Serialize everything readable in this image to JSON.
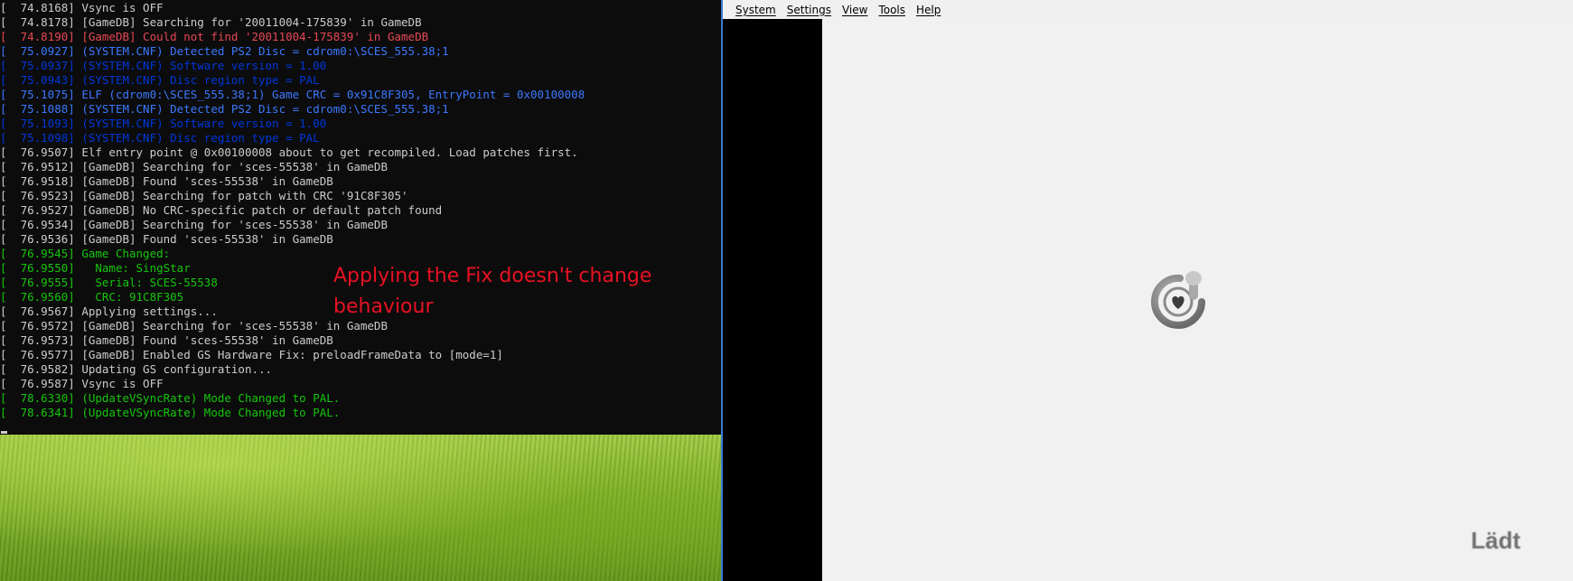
{
  "console": {
    "lines": [
      {
        "time": "74.8168",
        "text": "Vsync is OFF",
        "color": "default"
      },
      {
        "time": "74.8178",
        "text": "[GameDB] Searching for '20011004-175839' in GameDB",
        "color": "default"
      },
      {
        "time": "74.8190",
        "text": "[GameDB] Could not find '20011004-175839' in GameDB",
        "color": "red"
      },
      {
        "time": "75.0927",
        "text": "(SYSTEM.CNF) Detected PS2 Disc = cdrom0:\\SCES_555.38;1",
        "color": "blue"
      },
      {
        "time": "75.0937",
        "text": "(SYSTEM.CNF) Software version = 1.00",
        "color": "darkblue"
      },
      {
        "time": "75.0943",
        "text": "(SYSTEM.CNF) Disc region type = PAL",
        "color": "darkblue"
      },
      {
        "time": "75.1075",
        "text": "ELF (cdrom0:\\SCES_555.38;1) Game CRC = 0x91C8F305, EntryPoint = 0x00100008",
        "color": "blue"
      },
      {
        "time": "75.1088",
        "text": "(SYSTEM.CNF) Detected PS2 Disc = cdrom0:\\SCES_555.38;1",
        "color": "blue"
      },
      {
        "time": "75.1093",
        "text": "(SYSTEM.CNF) Software version = 1.00",
        "color": "darkblue"
      },
      {
        "time": "75.1098",
        "text": "(SYSTEM.CNF) Disc region type = PAL",
        "color": "darkblue"
      },
      {
        "time": "76.9507",
        "text": "Elf entry point @ 0x00100008 about to get recompiled. Load patches first.",
        "color": "default"
      },
      {
        "time": "76.9512",
        "text": "[GameDB] Searching for 'sces-55538' in GameDB",
        "color": "default"
      },
      {
        "time": "76.9518",
        "text": "[GameDB] Found 'sces-55538' in GameDB",
        "color": "default"
      },
      {
        "time": "76.9523",
        "text": "[GameDB] Searching for patch with CRC '91C8F305'",
        "color": "default"
      },
      {
        "time": "76.9527",
        "text": "[GameDB] No CRC-specific patch or default patch found",
        "color": "default"
      },
      {
        "time": "76.9534",
        "text": "[GameDB] Searching for 'sces-55538' in GameDB",
        "color": "default"
      },
      {
        "time": "76.9536",
        "text": "[GameDB] Found 'sces-55538' in GameDB",
        "color": "default"
      },
      {
        "time": "76.9545",
        "text": "Game Changed:",
        "color": "green"
      },
      {
        "time": "76.9550",
        "text": "  Name: SingStar",
        "color": "green"
      },
      {
        "time": "76.9555",
        "text": "  Serial: SCES-55538",
        "color": "green"
      },
      {
        "time": "76.9560",
        "text": "  CRC: 91C8F305",
        "color": "green"
      },
      {
        "time": "76.9567",
        "text": "Applying settings...",
        "color": "default"
      },
      {
        "time": "76.9572",
        "text": "[GameDB] Searching for 'sces-55538' in GameDB",
        "color": "default"
      },
      {
        "time": "76.9573",
        "text": "[GameDB] Found 'sces-55538' in GameDB",
        "color": "default"
      },
      {
        "time": "76.9577",
        "text": "[GameDB] Enabled GS Hardware Fix: preloadFrameData to [mode=1]",
        "color": "default"
      },
      {
        "time": "76.9582",
        "text": "Updating GS configuration...",
        "color": "default"
      },
      {
        "time": "76.9587",
        "text": "Vsync is OFF",
        "color": "default"
      },
      {
        "time": "78.6330",
        "text": "(UpdateVSyncRate) Mode Changed to PAL.",
        "color": "green"
      },
      {
        "time": "78.6341",
        "text": "(UpdateVSyncRate) Mode Changed to PAL.",
        "color": "green"
      }
    ]
  },
  "annotation": {
    "text": "Applying the Fix doesn't change behaviour",
    "color": "#e81123"
  },
  "emulator": {
    "menu": [
      "System",
      "Settings",
      "View",
      "Tools",
      "Help"
    ],
    "logo_icon": "singstar-mic-icon",
    "loading_text": "Lädt"
  },
  "colors": {
    "console_bg": "#0c0c0c",
    "window_border": "#3a7bd5"
  }
}
